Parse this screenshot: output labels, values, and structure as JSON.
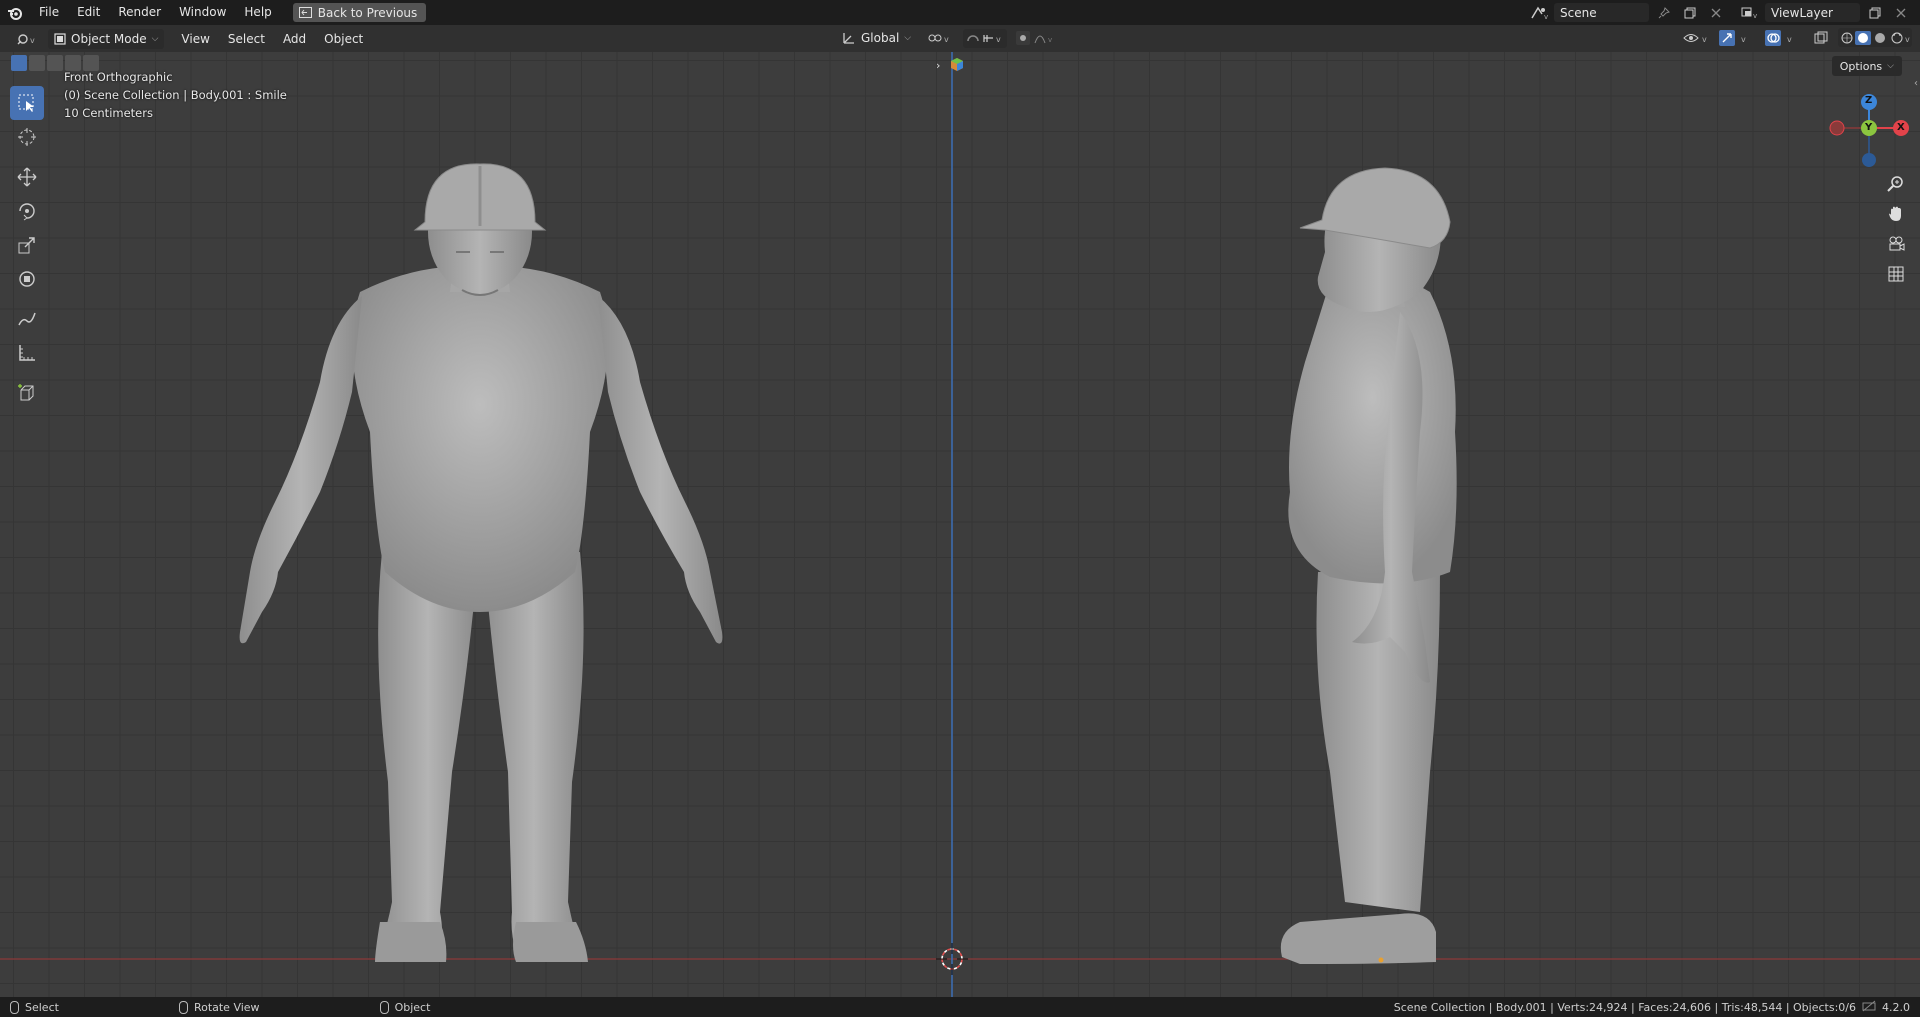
{
  "topbar": {
    "menus": [
      "File",
      "Edit",
      "Render",
      "Window",
      "Help"
    ],
    "back_label": "Back to Previous",
    "scene": "Scene",
    "view_layer": "ViewLayer"
  },
  "header": {
    "mode": "Object Mode",
    "menus": [
      "View",
      "Select",
      "Add",
      "Object"
    ],
    "orientation": "Global",
    "options": "Options"
  },
  "viewport": {
    "view_name": "Front Orthographic",
    "collection_line": "(0) Scene Collection | Body.001 : Smile",
    "scale": "10 Centimeters",
    "gizmo": {
      "z": "Z",
      "y": "Y",
      "x": "X"
    }
  },
  "status": {
    "hints": [
      "Select",
      "Rotate View",
      "Object"
    ],
    "stats": "Scene Collection | Body.001 | Verts:24,924 | Faces:24,606 | Tris:48,544 | Objects:0/6",
    "version": "4.2.0"
  },
  "colors": {
    "accent": "#4772b3",
    "x_axis": "#e2434a",
    "y_axis": "#8bc53f",
    "z_axis": "#3c86d9"
  }
}
